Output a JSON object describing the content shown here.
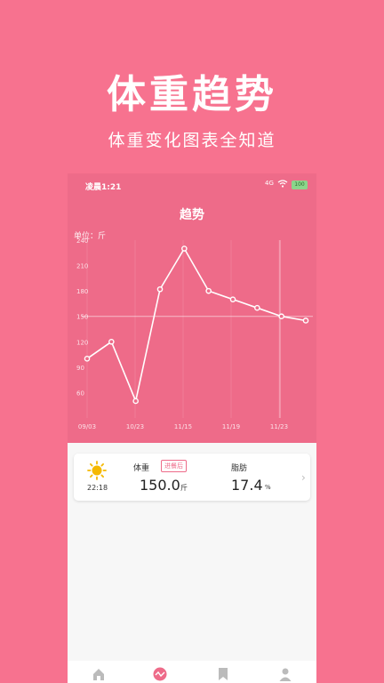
{
  "promo": {
    "title": "体重趋势",
    "subtitle": "体重变化图表全知道"
  },
  "status_bar": {
    "time": "凌晨1:21",
    "signal_text": "4G",
    "battery_text": "100"
  },
  "screen": {
    "title": "趋势"
  },
  "chart_data": {
    "type": "line",
    "unit_label": "单位：斤",
    "y_ticks": [
      60,
      90,
      120,
      150,
      180,
      210,
      240
    ],
    "x_tick_labels": [
      "09/03",
      "10/23",
      "11/15",
      "11/19",
      "11/23"
    ],
    "ylim": [
      30,
      240
    ],
    "reference_value": 150,
    "values": [
      100,
      120,
      50,
      182,
      230,
      180,
      170,
      160,
      150,
      145
    ],
    "color": "#ffffff"
  },
  "record_card": {
    "time": "22:18",
    "weight_label": "体重",
    "tag": "进餐后",
    "weight_value": "150.0",
    "weight_unit": "斤",
    "fat_label": "脂肪",
    "fat_value": "17.4",
    "fat_unit": "%",
    "chevron": "›"
  },
  "tabs": [
    {
      "name": "home",
      "icon": "home-icon"
    },
    {
      "name": "trend",
      "icon": "trend-icon"
    },
    {
      "name": "bookmark",
      "icon": "bookmark-icon"
    },
    {
      "name": "profile",
      "icon": "profile-icon"
    }
  ],
  "colors": {
    "background": "#f7728f",
    "header": "#ee6b89",
    "accent": "#ee6b89",
    "sun": "#f5b800"
  }
}
